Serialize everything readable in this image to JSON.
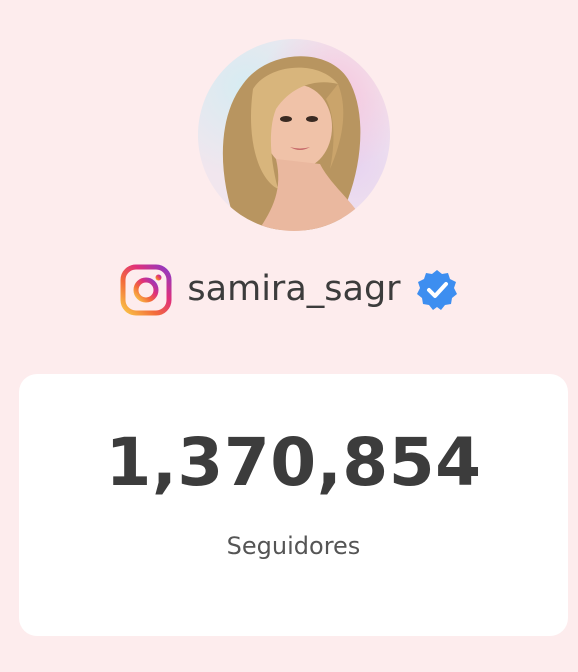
{
  "profile": {
    "avatar_icon": "profile-photo",
    "username": "samira_sagr",
    "platform_icon": "instagram-icon",
    "verified_icon": "verified-badge-icon"
  },
  "stats": {
    "followers_count": "1,370,854",
    "followers_label": "Seguidores"
  },
  "colors": {
    "background": "#fdeced",
    "card": "#ffffff",
    "text": "#3c3c3c",
    "verified_blue": "#3d8ef0"
  }
}
